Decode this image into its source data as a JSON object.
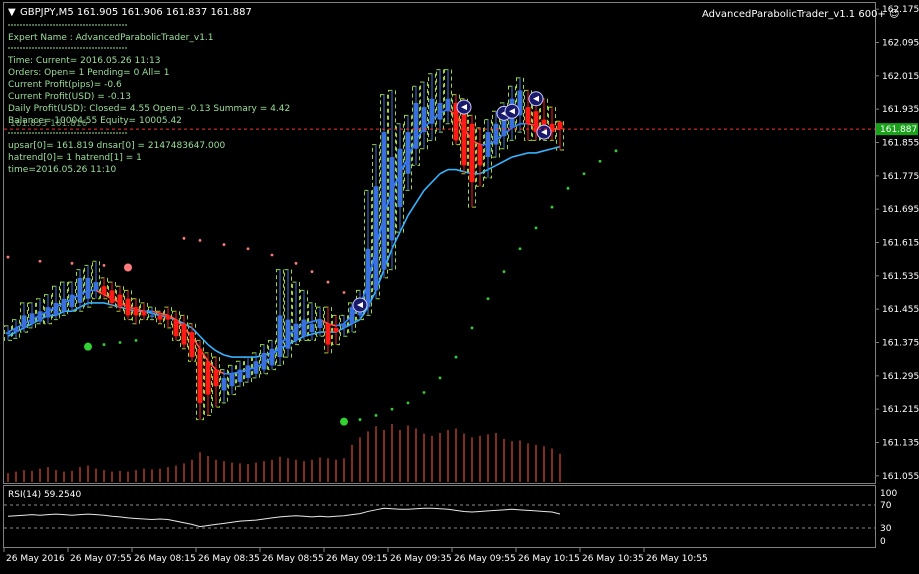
{
  "window": {
    "title": "GBPJPY,M5  161.905 161.906 161.837 161.887",
    "expert_label": "AdvancedParabolicTrader_v1.1 600+ ☺",
    "current_price_label": "161.887"
  },
  "info_panel": {
    "expert_name": "Expert Name : AdvancedParabolicTrader_v1.1",
    "time": "Time: Current= 2016.05.26 11:13",
    "orders": "Orders: Open= 1 Pending= 0 All= 1",
    "profit_pips": "Current Profit(pips)= -0.6",
    "profit_usd": "Current Profit(USD) = -0.13",
    "daily_profit": "Daily Profit(USD): Closed= 4.55 Open= -0.13 Summary = 4.42",
    "balance": "Balance= 10004.55 Equity= 10005.42",
    "balance_overlap": "161.853 161.816",
    "sar": "upsar[0]= 161.819 dnsar[0] = 2147483647.000",
    "hatrend": "hatrend[0]= 1 hatrend[1] = 1",
    "bar_time": "time=2016.05.26 11:10"
  },
  "price_axis": {
    "labels": [
      "162.175",
      "162.095",
      "162.015",
      "161.935",
      "161.855",
      "161.775",
      "161.695",
      "161.615",
      "161.535",
      "161.455",
      "161.375",
      "161.295",
      "161.215",
      "161.135",
      "161.055"
    ]
  },
  "rsi_panel": {
    "label": "RSI(14) 59.2540",
    "levels": [
      "100",
      "70",
      "30",
      "0"
    ]
  },
  "time_axis": {
    "labels": [
      "26 May 2016",
      "26 May 07:55",
      "26 May 08:15",
      "26 May 08:35",
      "26 May 08:55",
      "26 May 09:15",
      "26 May 09:35",
      "26 May 09:55",
      "26 May 10:15",
      "26 May 10:35",
      "26 May 10:55"
    ]
  },
  "colors": {
    "background": "#000000",
    "bull_candle": "#3b6fe0",
    "bear_candle": "#ff1a1a",
    "wick_up": "#3b6fe0",
    "ha_outline": "#b6ff3c",
    "ma_fast_up": "#2f8bff",
    "ma_slow": "#36b4ff",
    "ma_down": "#ff5a4a",
    "sar_down": "#ff7a7a",
    "sar_up": "#32d232",
    "volume": "#ff5a3a",
    "text": "#ffffff",
    "grid": "#6b6b6b",
    "price_line": "#ff3030",
    "price_box_bg": "#1aa31a"
  },
  "chart_data": {
    "type": "candlestick",
    "symbol": "GBPJPY",
    "timeframe": "M5",
    "ylim": [
      161.045,
      162.185
    ],
    "current_price": 161.887,
    "last_bar": {
      "open": 161.905,
      "high": 161.906,
      "low": 161.837,
      "close": 161.887
    },
    "bars": [
      {
        "o": 161.395,
        "h": 161.415,
        "l": 161.38,
        "c": 161.4
      },
      {
        "o": 161.4,
        "h": 161.43,
        "l": 161.385,
        "c": 161.41
      },
      {
        "o": 161.41,
        "h": 161.47,
        "l": 161.4,
        "c": 161.44
      },
      {
        "o": 161.42,
        "h": 161.47,
        "l": 161.41,
        "c": 161.445
      },
      {
        "o": 161.425,
        "h": 161.48,
        "l": 161.42,
        "c": 161.45
      },
      {
        "o": 161.435,
        "h": 161.49,
        "l": 161.42,
        "c": 161.46
      },
      {
        "o": 161.44,
        "h": 161.51,
        "l": 161.43,
        "c": 161.47
      },
      {
        "o": 161.45,
        "h": 161.52,
        "l": 161.44,
        "c": 161.48
      },
      {
        "o": 161.46,
        "h": 161.52,
        "l": 161.45,
        "c": 161.49
      },
      {
        "o": 161.47,
        "h": 161.55,
        "l": 161.45,
        "c": 161.53
      },
      {
        "o": 161.48,
        "h": 161.56,
        "l": 161.46,
        "c": 161.53
      },
      {
        "o": 161.5,
        "h": 161.57,
        "l": 161.48,
        "c": 161.52
      },
      {
        "o": 161.51,
        "h": 161.53,
        "l": 161.48,
        "c": 161.49
      },
      {
        "o": 161.5,
        "h": 161.52,
        "l": 161.46,
        "c": 161.47
      },
      {
        "o": 161.49,
        "h": 161.51,
        "l": 161.45,
        "c": 161.46
      },
      {
        "o": 161.48,
        "h": 161.5,
        "l": 161.43,
        "c": 161.44
      },
      {
        "o": 161.46,
        "h": 161.48,
        "l": 161.42,
        "c": 161.44
      },
      {
        "o": 161.45,
        "h": 161.47,
        "l": 161.43,
        "c": 161.44
      },
      {
        "o": 161.44,
        "h": 161.46,
        "l": 161.43,
        "c": 161.44
      },
      {
        "o": 161.44,
        "h": 161.45,
        "l": 161.42,
        "c": 161.43
      },
      {
        "o": 161.44,
        "h": 161.46,
        "l": 161.41,
        "c": 161.43
      },
      {
        "o": 161.43,
        "h": 161.45,
        "l": 161.38,
        "c": 161.39
      },
      {
        "o": 161.42,
        "h": 161.44,
        "l": 161.36,
        "c": 161.37
      },
      {
        "o": 161.4,
        "h": 161.42,
        "l": 161.33,
        "c": 161.34
      },
      {
        "o": 161.36,
        "h": 161.38,
        "l": 161.19,
        "c": 161.23
      },
      {
        "o": 161.33,
        "h": 161.35,
        "l": 161.2,
        "c": 161.25
      },
      {
        "o": 161.31,
        "h": 161.34,
        "l": 161.22,
        "c": 161.27
      },
      {
        "o": 161.26,
        "h": 161.31,
        "l": 161.23,
        "c": 161.29
      },
      {
        "o": 161.27,
        "h": 161.32,
        "l": 161.25,
        "c": 161.3
      },
      {
        "o": 161.28,
        "h": 161.33,
        "l": 161.27,
        "c": 161.31
      },
      {
        "o": 161.29,
        "h": 161.34,
        "l": 161.28,
        "c": 161.32
      },
      {
        "o": 161.3,
        "h": 161.35,
        "l": 161.29,
        "c": 161.33
      },
      {
        "o": 161.31,
        "h": 161.37,
        "l": 161.3,
        "c": 161.35
      },
      {
        "o": 161.32,
        "h": 161.38,
        "l": 161.31,
        "c": 161.36
      },
      {
        "o": 161.34,
        "h": 161.55,
        "l": 161.32,
        "c": 161.44
      },
      {
        "o": 161.36,
        "h": 161.55,
        "l": 161.34,
        "c": 161.43
      },
      {
        "o": 161.38,
        "h": 161.52,
        "l": 161.37,
        "c": 161.42
      },
      {
        "o": 161.39,
        "h": 161.5,
        "l": 161.38,
        "c": 161.43
      },
      {
        "o": 161.4,
        "h": 161.47,
        "l": 161.38,
        "c": 161.42
      },
      {
        "o": 161.41,
        "h": 161.46,
        "l": 161.39,
        "c": 161.43
      },
      {
        "o": 161.42,
        "h": 161.46,
        "l": 161.35,
        "c": 161.37
      },
      {
        "o": 161.41,
        "h": 161.44,
        "l": 161.37,
        "c": 161.4
      },
      {
        "o": 161.41,
        "h": 161.44,
        "l": 161.39,
        "c": 161.42
      },
      {
        "o": 161.42,
        "h": 161.47,
        "l": 161.4,
        "c": 161.46
      },
      {
        "o": 161.44,
        "h": 161.5,
        "l": 161.43,
        "c": 161.48
      },
      {
        "o": 161.46,
        "h": 161.74,
        "l": 161.44,
        "c": 161.6
      },
      {
        "o": 161.5,
        "h": 161.85,
        "l": 161.48,
        "c": 161.75
      },
      {
        "o": 161.55,
        "h": 161.97,
        "l": 161.53,
        "c": 161.88
      },
      {
        "o": 161.62,
        "h": 161.98,
        "l": 161.55,
        "c": 161.82
      },
      {
        "o": 161.7,
        "h": 161.9,
        "l": 161.64,
        "c": 161.84
      },
      {
        "o": 161.78,
        "h": 161.92,
        "l": 161.74,
        "c": 161.88
      },
      {
        "o": 161.84,
        "h": 161.99,
        "l": 161.8,
        "c": 161.95
      },
      {
        "o": 161.88,
        "h": 162.0,
        "l": 161.84,
        "c": 161.94
      },
      {
        "o": 161.9,
        "h": 162.02,
        "l": 161.86,
        "c": 161.96
      },
      {
        "o": 161.91,
        "h": 162.03,
        "l": 161.88,
        "c": 161.95
      },
      {
        "o": 161.93,
        "h": 162.03,
        "l": 161.9,
        "c": 161.96
      },
      {
        "o": 161.95,
        "h": 161.97,
        "l": 161.85,
        "c": 161.86
      },
      {
        "o": 161.94,
        "h": 161.96,
        "l": 161.78,
        "c": 161.8
      },
      {
        "o": 161.9,
        "h": 161.92,
        "l": 161.7,
        "c": 161.76
      },
      {
        "o": 161.85,
        "h": 161.89,
        "l": 161.75,
        "c": 161.8
      },
      {
        "o": 161.82,
        "h": 161.91,
        "l": 161.77,
        "c": 161.88
      },
      {
        "o": 161.85,
        "h": 161.93,
        "l": 161.82,
        "c": 161.9
      },
      {
        "o": 161.87,
        "h": 161.95,
        "l": 161.84,
        "c": 161.94
      },
      {
        "o": 161.89,
        "h": 161.99,
        "l": 161.86,
        "c": 161.96
      },
      {
        "o": 161.92,
        "h": 162.01,
        "l": 161.88,
        "c": 161.98
      },
      {
        "o": 161.94,
        "h": 161.98,
        "l": 161.86,
        "c": 161.9
      },
      {
        "o": 161.93,
        "h": 161.97,
        "l": 161.86,
        "c": 161.88
      },
      {
        "o": 161.91,
        "h": 161.96,
        "l": 161.86,
        "c": 161.89
      },
      {
        "o": 161.9,
        "h": 161.94,
        "l": 161.86,
        "c": 161.88
      },
      {
        "o": 161.905,
        "h": 161.906,
        "l": 161.837,
        "c": 161.887
      }
    ],
    "ma_fast": [
      161.4,
      161.41,
      161.42,
      161.43,
      161.44,
      161.45,
      161.46,
      161.47,
      161.48,
      161.49,
      161.5,
      161.5,
      161.49,
      161.48,
      161.47,
      161.46,
      161.455,
      161.45,
      161.45,
      161.445,
      161.44,
      161.43,
      161.41,
      161.39,
      161.36,
      161.33,
      161.31,
      161.3,
      161.3,
      161.305,
      161.31,
      161.315,
      161.325,
      161.34,
      161.37,
      161.39,
      161.41,
      161.42,
      161.425,
      161.43,
      161.42,
      161.415,
      161.42,
      161.44,
      161.46,
      161.52,
      161.6,
      161.68,
      161.74,
      161.78,
      161.82,
      161.86,
      161.89,
      161.91,
      161.925,
      161.935,
      161.92,
      161.89,
      161.86,
      161.85,
      161.85,
      161.86,
      161.875,
      161.89,
      161.9,
      161.9,
      161.895,
      161.89,
      161.888,
      161.887
    ],
    "ma_slow": [
      161.39,
      161.4,
      161.41,
      161.42,
      161.43,
      161.44,
      161.44,
      161.45,
      161.45,
      161.46,
      161.47,
      161.47,
      161.47,
      161.465,
      161.46,
      161.455,
      161.45,
      161.45,
      161.445,
      161.44,
      161.435,
      161.43,
      161.42,
      161.41,
      161.39,
      161.37,
      161.355,
      161.345,
      161.34,
      161.34,
      161.34,
      161.34,
      161.345,
      161.35,
      161.36,
      161.37,
      161.38,
      161.39,
      161.395,
      161.4,
      161.4,
      161.4,
      161.41,
      161.42,
      161.43,
      161.46,
      161.5,
      161.55,
      161.6,
      161.64,
      161.68,
      161.71,
      161.74,
      161.76,
      161.78,
      161.79,
      161.79,
      161.785,
      161.78,
      161.78,
      161.79,
      161.8,
      161.81,
      161.82,
      161.825,
      161.83,
      161.83,
      161.835,
      161.84,
      161.845
    ],
    "sar_down": [
      {
        "i": 0,
        "v": 161.58
      },
      {
        "i": 4,
        "v": 161.57
      },
      {
        "i": 8,
        "v": 161.565
      },
      {
        "i": 12,
        "v": 161.56
      },
      {
        "i": 15,
        "v": 161.555
      },
      {
        "i": 22,
        "v": 161.625
      },
      {
        "i": 24,
        "v": 161.62
      },
      {
        "i": 27,
        "v": 161.61
      },
      {
        "i": 30,
        "v": 161.6
      },
      {
        "i": 33,
        "v": 161.585
      },
      {
        "i": 36,
        "v": 161.565
      },
      {
        "i": 38,
        "v": 161.545
      },
      {
        "i": 40,
        "v": 161.52
      },
      {
        "i": 42,
        "v": 161.495
      }
    ],
    "sar_up": [
      {
        "i": 10,
        "v": 161.365
      },
      {
        "i": 12,
        "v": 161.37
      },
      {
        "i": 14,
        "v": 161.375
      },
      {
        "i": 16,
        "v": 161.38
      },
      {
        "i": 42,
        "v": 161.185
      },
      {
        "i": 44,
        "v": 161.19
      },
      {
        "i": 46,
        "v": 161.2
      },
      {
        "i": 48,
        "v": 161.215
      },
      {
        "i": 50,
        "v": 161.23
      },
      {
        "i": 52,
        "v": 161.255
      },
      {
        "i": 54,
        "v": 161.29
      },
      {
        "i": 56,
        "v": 161.34
      },
      {
        "i": 58,
        "v": 161.41
      },
      {
        "i": 60,
        "v": 161.48
      },
      {
        "i": 62,
        "v": 161.545
      },
      {
        "i": 64,
        "v": 161.6
      },
      {
        "i": 66,
        "v": 161.65
      },
      {
        "i": 68,
        "v": 161.7
      },
      {
        "i": 70,
        "v": 161.745
      },
      {
        "i": 72,
        "v": 161.78
      },
      {
        "i": 74,
        "v": 161.81
      },
      {
        "i": 76,
        "v": 161.835
      }
    ],
    "volumes": [
      12,
      14,
      16,
      15,
      18,
      20,
      16,
      14,
      15,
      20,
      22,
      18,
      16,
      14,
      15,
      14,
      16,
      18,
      17,
      18,
      20,
      22,
      25,
      30,
      40,
      35,
      30,
      28,
      26,
      25,
      24,
      26,
      28,
      30,
      34,
      32,
      30,
      28,
      30,
      33,
      32,
      30,
      32,
      50,
      60,
      68,
      75,
      70,
      78,
      70,
      76,
      72,
      65,
      62,
      66,
      70,
      72,
      65,
      60,
      62,
      64,
      66,
      58,
      55,
      56,
      52,
      50,
      48,
      45,
      38
    ],
    "rsi": [
      55,
      56,
      57,
      58,
      57,
      58,
      59,
      58,
      57,
      58,
      59,
      58,
      57,
      55,
      54,
      52,
      51,
      50,
      49,
      50,
      49,
      46,
      43,
      40,
      36,
      38,
      40,
      42,
      44,
      46,
      47,
      48,
      50,
      52,
      54,
      55,
      56,
      55,
      54,
      55,
      54,
      55,
      56,
      58,
      60,
      64,
      67,
      70,
      69,
      68,
      68,
      69,
      70,
      70,
      69,
      68,
      66,
      64,
      63,
      64,
      65,
      66,
      67,
      68,
      67,
      66,
      65,
      64,
      63,
      59.254
    ],
    "arrow_signals": [
      {
        "bar": 44,
        "v": 161.465
      },
      {
        "bar": 57,
        "v": 161.94
      },
      {
        "bar": 62,
        "v": 161.925
      },
      {
        "bar": 63,
        "v": 161.93
      },
      {
        "bar": 66,
        "v": 161.96
      },
      {
        "bar": 67,
        "v": 161.88
      }
    ]
  }
}
